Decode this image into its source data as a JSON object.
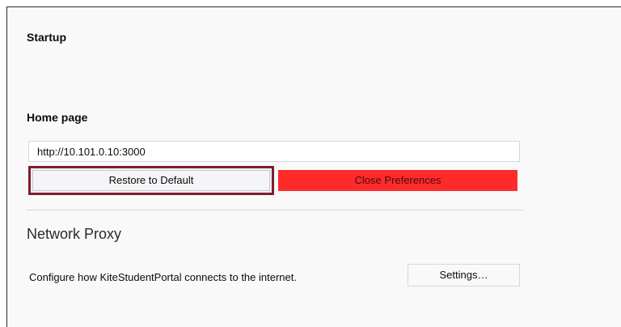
{
  "startup": {
    "title": "Startup"
  },
  "home_page": {
    "title": "Home page",
    "url_value": "http://10.101.0.10:3000",
    "restore_label": "Restore to Default",
    "close_label": "Close Preferences"
  },
  "network_proxy": {
    "title": "Network Proxy",
    "description": "Configure how KiteStudentPortal connects to the internet.",
    "settings_label": "Settings…"
  },
  "colors": {
    "close_button_bg": "#ff2b2b",
    "restore_highlight_border": "#7a1f2e"
  }
}
